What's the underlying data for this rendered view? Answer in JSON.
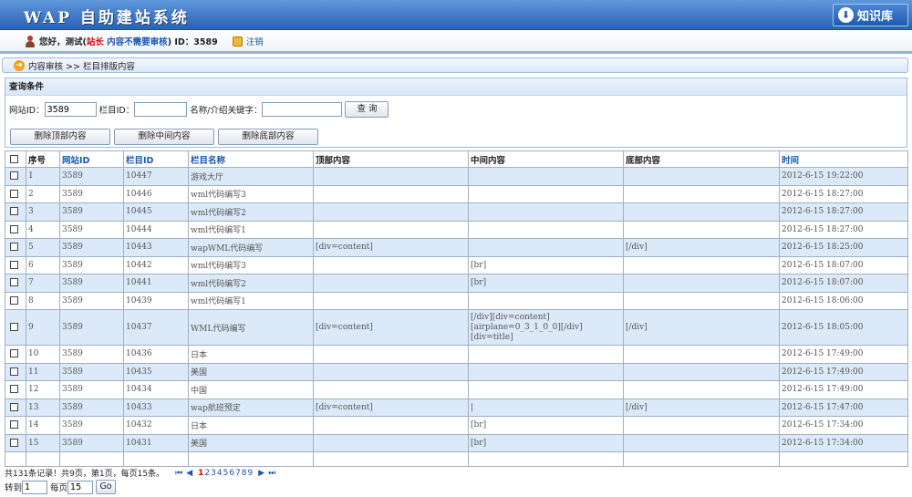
{
  "header": {
    "title": "WAP 自助建站系统",
    "kb_label": "知识库"
  },
  "user": {
    "greeting": "您好，测试(",
    "role": "站长",
    "note": "内容不需要审核",
    "close": ")  ID：3589",
    "logout": "注销"
  },
  "breadcrumb": {
    "text": "内容审核  >> 栏目排版内容"
  },
  "query": {
    "title": "查询条件",
    "site_id_label": "网站ID：",
    "site_id_value": "3589",
    "col_id_label": "栏目ID：",
    "col_id_value": "",
    "keyword_label": "名称/介绍关键字：",
    "keyword_value": "",
    "search_label": "查 询",
    "del_top_label": "删除顶部内容",
    "del_mid_label": "删除中间内容",
    "del_bottom_label": "删除底部内容"
  },
  "table": {
    "headers": {
      "no": "序号",
      "site_id": "网站ID",
      "col_id": "栏目ID",
      "col_name": "栏目名称",
      "top": "顶部内容",
      "mid": "中间内容",
      "bottom": "底部内容",
      "time": "时间"
    },
    "rows": [
      {
        "no": "1",
        "site": "3589",
        "col": "10447",
        "name": "游戏大厅",
        "top": "",
        "mid": "",
        "bottom": "",
        "time": "2012-6-15 19:22:00"
      },
      {
        "no": "2",
        "site": "3589",
        "col": "10446",
        "name": "wml代码编写3",
        "top": "",
        "mid": "",
        "bottom": "",
        "time": "2012-6-15 18:27:00"
      },
      {
        "no": "3",
        "site": "3589",
        "col": "10445",
        "name": "wml代码编写2",
        "top": "",
        "mid": "",
        "bottom": "",
        "time": "2012-6-15 18:27:00"
      },
      {
        "no": "4",
        "site": "3589",
        "col": "10444",
        "name": "wml代码编写1",
        "top": "",
        "mid": "",
        "bottom": "",
        "time": "2012-6-15 18:27:00"
      },
      {
        "no": "5",
        "site": "3589",
        "col": "10443",
        "name": "wapWML代码编写",
        "top": "[div=content]",
        "mid": "",
        "bottom": "[/div]",
        "time": "2012-6-15 18:25:00"
      },
      {
        "no": "6",
        "site": "3589",
        "col": "10442",
        "name": "wml代码编写3",
        "top": "",
        "mid": "[br]",
        "bottom": "",
        "time": "2012-6-15 18:07:00"
      },
      {
        "no": "7",
        "site": "3589",
        "col": "10441",
        "name": "wml代码编写2",
        "top": "",
        "mid": "[br]",
        "bottom": "",
        "time": "2012-6-15 18:07:00"
      },
      {
        "no": "8",
        "site": "3589",
        "col": "10439",
        "name": "wml代码编写1",
        "top": "",
        "mid": "",
        "bottom": "",
        "time": "2012-6-15 18:06:00"
      },
      {
        "no": "9",
        "site": "3589",
        "col": "10437",
        "name": "WML代码编写",
        "top": "[div=content]",
        "mid": "[/div][div=content]\n[airplane=0_3_1_0_0][/div]\n[div=title]",
        "bottom": "[/div]",
        "time": "2012-6-15 18:05:00"
      },
      {
        "no": "10",
        "site": "3589",
        "col": "10436",
        "name": "日本",
        "top": "",
        "mid": "",
        "bottom": "",
        "time": "2012-6-15 17:49:00"
      },
      {
        "no": "11",
        "site": "3589",
        "col": "10435",
        "name": "美国",
        "top": "",
        "mid": "",
        "bottom": "",
        "time": "2012-6-15 17:49:00"
      },
      {
        "no": "12",
        "site": "3589",
        "col": "10434",
        "name": "中国",
        "top": "",
        "mid": "",
        "bottom": "",
        "time": "2012-6-15 17:49:00"
      },
      {
        "no": "13",
        "site": "3589",
        "col": "10433",
        "name": "wap航班预定",
        "top": "[div=content]",
        "mid": "|",
        "bottom": "[/div]",
        "time": "2012-6-15 17:47:00"
      },
      {
        "no": "14",
        "site": "3589",
        "col": "10432",
        "name": "日本",
        "top": "",
        "mid": "[br]",
        "bottom": "",
        "time": "2012-6-15 17:34:00"
      },
      {
        "no": "15",
        "site": "3589",
        "col": "10431",
        "name": "美国",
        "top": "",
        "mid": "[br]",
        "bottom": "",
        "time": "2012-6-15 17:34:00"
      }
    ]
  },
  "pager": {
    "summary": "共131条记录！共9页，第1页，每页15条。",
    "first": "⏮",
    "prev": "◀",
    "next": "▶",
    "last": "⏭",
    "pages": [
      "1",
      "2",
      "3",
      "4",
      "5",
      "6",
      "7",
      "8",
      "9"
    ],
    "current": "1",
    "goto_label": "转到",
    "goto_value": "1",
    "per_page_label": "每页",
    "per_page_value": "15",
    "go_label": "Go"
  }
}
